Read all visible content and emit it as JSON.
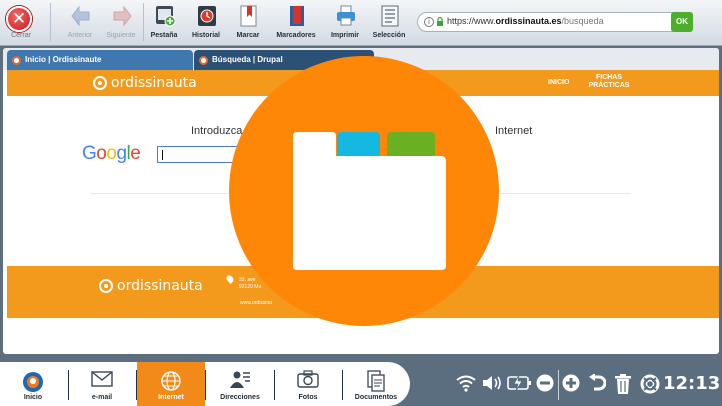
{
  "toolbar": {
    "close_label": "Cerrar",
    "items": [
      {
        "label": "Anterior",
        "icon": "arrow-left-icon",
        "enabled": false
      },
      {
        "label": "Siguiente",
        "icon": "arrow-right-icon",
        "enabled": false
      },
      {
        "label": "Pestaña",
        "icon": "new-tab-icon",
        "enabled": true
      },
      {
        "label": "Historial",
        "icon": "history-icon",
        "enabled": true
      },
      {
        "label": "Marcar",
        "icon": "bookmark-icon",
        "enabled": true
      },
      {
        "label": "Marcadores",
        "icon": "bookmarks-icon",
        "enabled": true
      },
      {
        "label": "Imprimir",
        "icon": "printer-icon",
        "enabled": true
      },
      {
        "label": "Selección",
        "icon": "selection-icon",
        "enabled": true
      }
    ]
  },
  "address_bar": {
    "scheme": "https://www.",
    "domain": "ordissinauta.es",
    "path": "/busqueda",
    "go_label": "OK"
  },
  "tabs": [
    {
      "label": "Inicio | Ordissinaute"
    },
    {
      "label": "Búsqueda | Drupal"
    }
  ],
  "page": {
    "logo_text": "ordissinauta",
    "nav": [
      {
        "label": "INICIO"
      },
      {
        "label": "FICHAS PRÁCTICAS"
      }
    ],
    "search_prompt_left": "Introduzca",
    "search_prompt_right": "Internet",
    "google_letters": [
      {
        "ch": "G",
        "color": "#4285f4"
      },
      {
        "ch": "o",
        "color": "#ea4335"
      },
      {
        "ch": "o",
        "color": "#fbbc05"
      },
      {
        "ch": "g",
        "color": "#4285f4"
      },
      {
        "ch": "l",
        "color": "#34a853"
      },
      {
        "ch": "e",
        "color": "#ea4335"
      }
    ],
    "footer": {
      "logo_text": "ordissinauta",
      "address_line1": "33, ave",
      "address_line2": "92120 Mo",
      "site": "www.ordissina"
    }
  },
  "overlay": {
    "icon": "folder-icon",
    "color": "#ff8708",
    "tab_colors": [
      "#ffffff",
      "#14b8e0",
      "#6ab023"
    ]
  },
  "taskbar": {
    "items": [
      {
        "label": "Inicio",
        "icon": "home-logo-icon",
        "active": false
      },
      {
        "label": "e-mail",
        "icon": "envelope-icon",
        "active": false
      },
      {
        "label": "Internet",
        "icon": "globe-icon",
        "active": true
      },
      {
        "label": "Direcciones",
        "icon": "contacts-icon",
        "active": false
      },
      {
        "label": "Fotos",
        "icon": "camera-icon",
        "active": false
      },
      {
        "label": "Documentos",
        "icon": "documents-icon",
        "active": false
      }
    ],
    "system_icons": [
      "wifi-icon",
      "volume-icon",
      "battery-charging-icon",
      "zoom-out-icon",
      "zoom-in-icon",
      "undo-icon",
      "trash-icon",
      "help-lifebuoy-icon"
    ],
    "clock": "12:13"
  }
}
